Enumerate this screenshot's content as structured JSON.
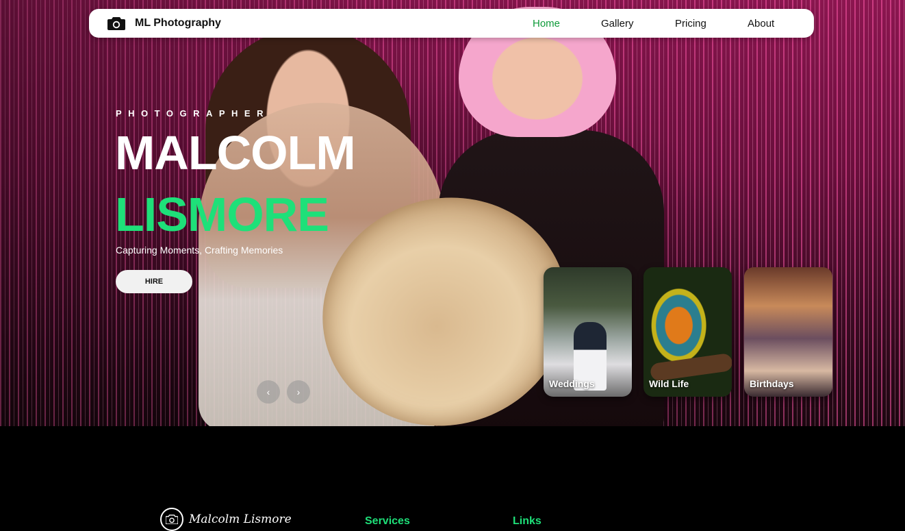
{
  "colors": {
    "accent_green": "#1ee079",
    "nav_active": "#0d9a38",
    "nav_bg": "#ffffff",
    "footer_bg": "#000000",
    "hero_tint": "#8c1650"
  },
  "nav": {
    "brand_icon": "camera-icon",
    "brand_name": "ML Photography",
    "links": [
      {
        "label": "Home",
        "active": true
      },
      {
        "label": "Gallery",
        "active": false
      },
      {
        "label": "Pricing",
        "active": false
      },
      {
        "label": "About",
        "active": false
      }
    ]
  },
  "hero": {
    "eyebrow": "PHOTOGRAPHER",
    "first_name": "MALCOLM",
    "last_name": "LISMORE",
    "tagline": "Capturing Moments, Crafting Memories",
    "cta_label": "HIRE",
    "prev_arrow": "‹",
    "next_arrow": "›"
  },
  "categories": [
    {
      "label": "Weddings"
    },
    {
      "label": "Wild Life"
    },
    {
      "label": "Birthdays"
    }
  ],
  "footer": {
    "brand_name": "Malcolm Lismore",
    "brand_icon": "camera-icon",
    "services_heading": "Services",
    "links_heading": "Links"
  }
}
